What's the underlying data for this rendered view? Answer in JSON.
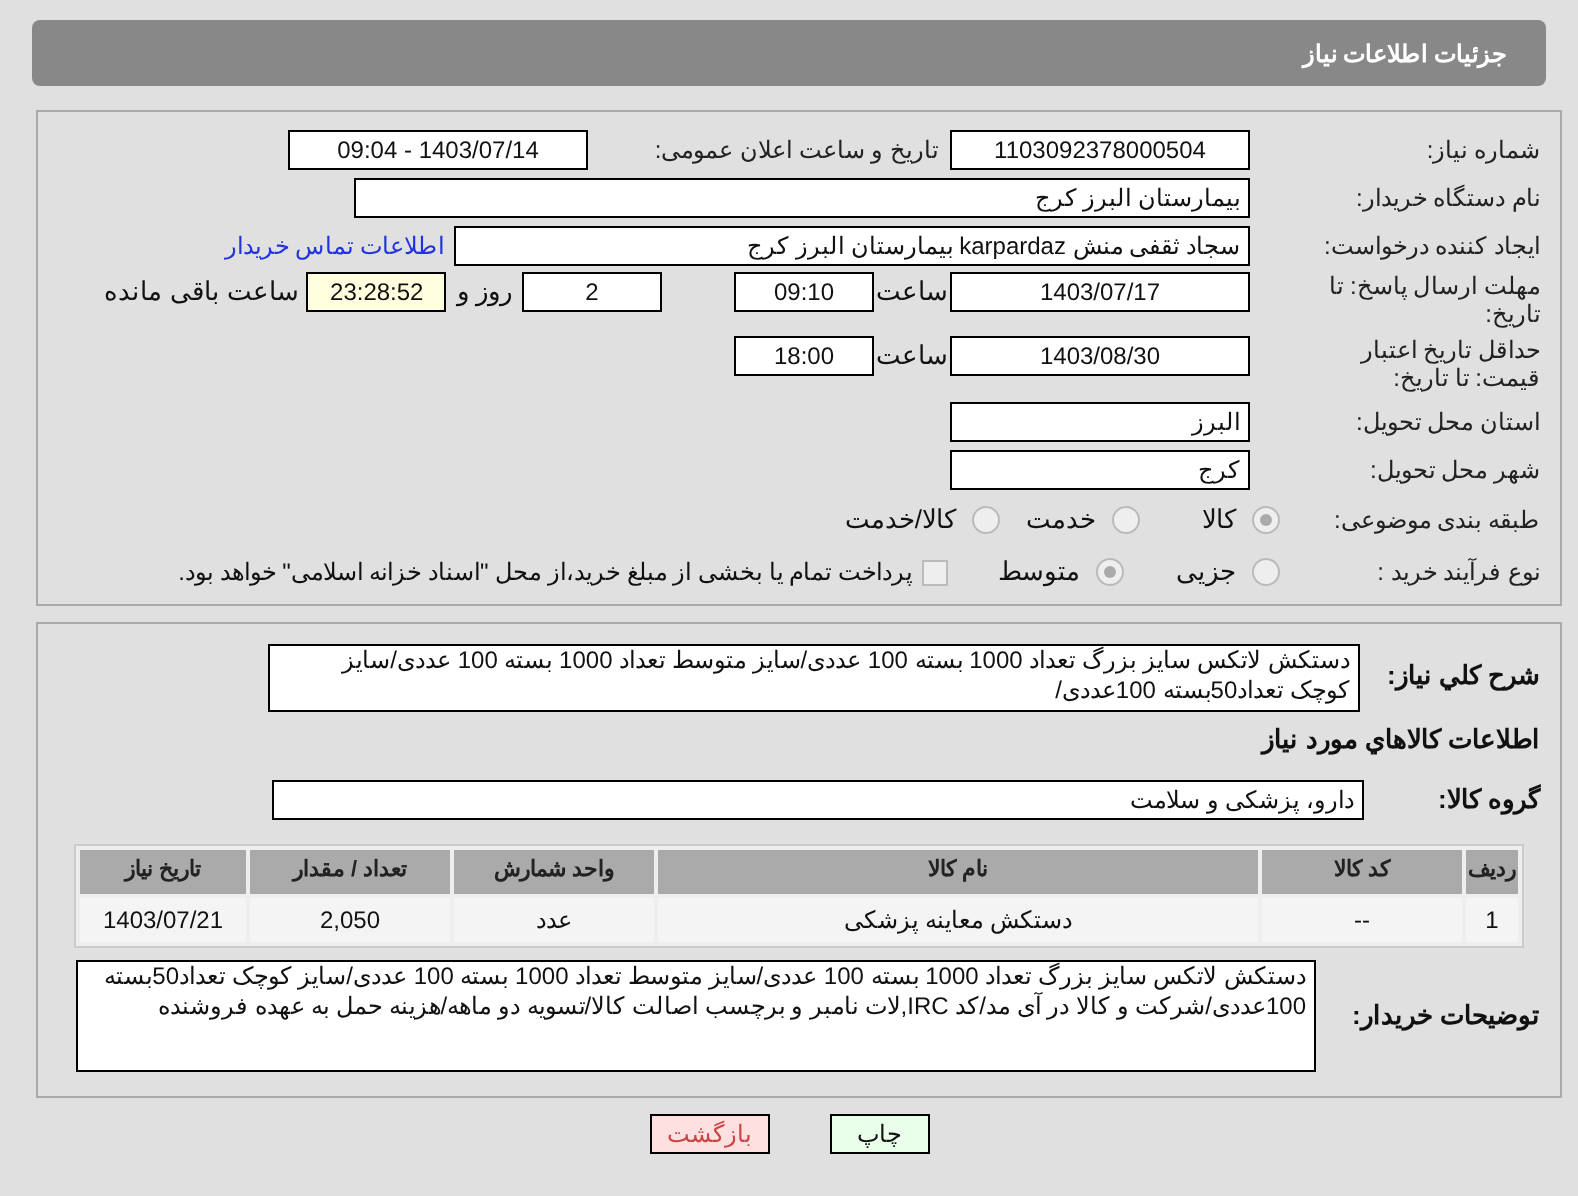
{
  "header": {
    "title": "جزئیات اطلاعات نیاز"
  },
  "need_number": {
    "label": "شماره نیاز:",
    "value": "1103092378000504"
  },
  "announce": {
    "label": "تاریخ و ساعت اعلان عمومی:",
    "value": "1403/07/14 - 09:04"
  },
  "buyer": {
    "label": "نام دستگاه خریدار:",
    "value": "بیمارستان البرز کرج"
  },
  "requester": {
    "label": "ایجاد کننده درخواست:",
    "value": "سجاد ثقفی منش karpardaz بیمارستان البرز کرج",
    "link": "اطلاعات تماس خریدار"
  },
  "deadline": {
    "label": "مهلت ارسال پاسخ: تا تاریخ:",
    "date": "1403/07/17",
    "time_label": "ساعت",
    "time": "09:10",
    "days": "2",
    "days_label": "روز و",
    "remaining": "23:28:52",
    "remaining_label": "ساعت باقی مانده"
  },
  "validity": {
    "label": "حداقل تاریخ اعتبار قیمت: تا تاریخ:",
    "date": "1403/08/30",
    "time_label": "ساعت",
    "time": "18:00"
  },
  "province": {
    "label": "استان محل تحویل:",
    "value": "البرز"
  },
  "city": {
    "label": "شهر محل تحویل:",
    "value": "کرج"
  },
  "category": {
    "label": "طبقه بندی موضوعی:",
    "options": [
      {
        "label": "کالا",
        "selected": true
      },
      {
        "label": "خدمت",
        "selected": false
      },
      {
        "label": "کالا/خدمت",
        "selected": false
      }
    ]
  },
  "process": {
    "label": "نوع فرآیند خرید :",
    "options": [
      {
        "label": "جزیی",
        "selected": false
      },
      {
        "label": "متوسط",
        "selected": true
      }
    ],
    "payment_note": {
      "checked": false,
      "text": "پرداخت تمام یا بخشی از مبلغ خرید،از محل \"اسناد خزانه اسلامی\" خواهد بود."
    }
  },
  "description": {
    "label": "شرح کلي نياز:",
    "value": "دستکش لاتکس سایز بزرگ تعداد 1000 بسته 100 عددی/سایز متوسط تعداد 1000 بسته 100 عددی/سایز کوچک تعداد50بسته 100عددی/"
  },
  "goods_title": "اطلاعات کالاهاي مورد نياز",
  "group": {
    "label": "گروه کالا:",
    "value": "دارو، پزشکی و سلامت"
  },
  "table": {
    "columns": [
      "ردیف",
      "کد کالا",
      "نام کالا",
      "واحد شمارش",
      "تعداد / مقدار",
      "تاریخ نیاز"
    ],
    "rows": [
      [
        "1",
        "--",
        "دستکش معاینه پزشکی",
        "عدد",
        "2,050",
        "1403/07/21"
      ]
    ]
  },
  "buyer_notes": {
    "label": "توضیحات خریدار:",
    "value": "دستکش لاتکس سایز بزرگ تعداد 1000 بسته 100 عددی/سایز متوسط تعداد 1000 بسته 100 عددی/سایز کوچک تعداد50بسته 100عددی/شرکت و کالا در آی مد/کد IRC,لات نامبر و برچسب اصالت کالا/تسویه دو ماهه/هزینه حمل به عهده فروشنده"
  },
  "buttons": [
    {
      "label": "چاپ",
      "kind": "print"
    },
    {
      "label": "بازگشت",
      "kind": "back"
    }
  ]
}
